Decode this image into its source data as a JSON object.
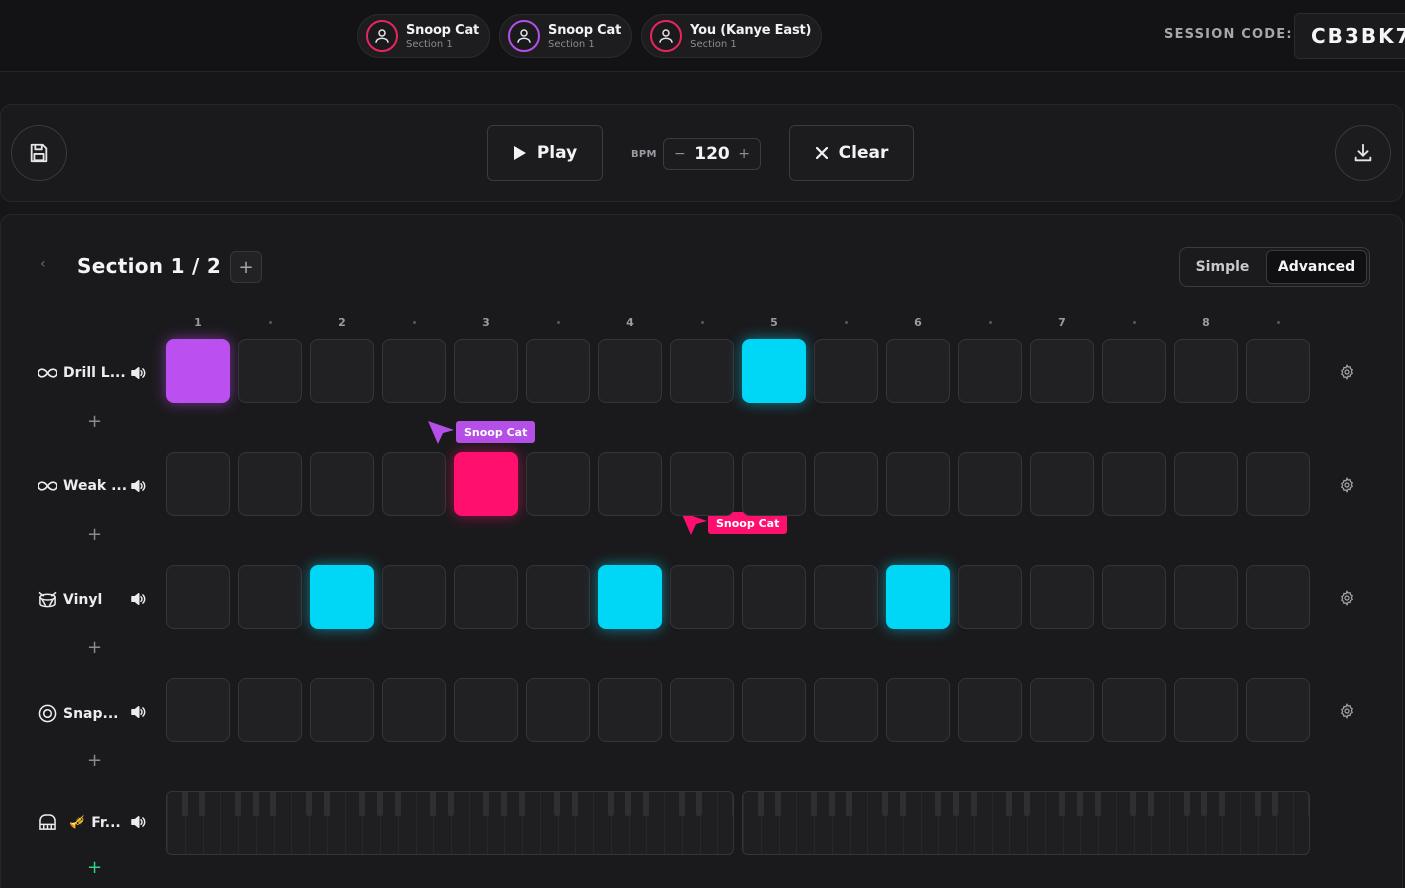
{
  "header": {
    "users": [
      {
        "name": "Snoop Cat",
        "section": "Section 1",
        "color": "#e8265e"
      },
      {
        "name": "Snoop Cat",
        "section": "Section 1",
        "color": "#b44fe8"
      },
      {
        "name": "You (Kanye East)",
        "section": "Section 1",
        "color": "#e8265e"
      }
    ],
    "session_label": "SESSION CODE:",
    "session_code": "CB3BK7"
  },
  "toolbar": {
    "save_icon": "save-icon",
    "play_label": "Play",
    "bpm_label": "BPM",
    "bpm_value": "120",
    "bpm_decrease": "−",
    "bpm_increase": "+",
    "clear_label": "Clear",
    "download_icon": "download-icon"
  },
  "section": {
    "prev": "‹",
    "title": "Section 1 / 2",
    "add": "+",
    "mode_simple": "Simple",
    "mode_advanced": "Advanced"
  },
  "steps": {
    "labels": [
      "1",
      "2",
      "3",
      "4",
      "5",
      "6",
      "7",
      "8"
    ]
  },
  "tracks": [
    {
      "name": "Drill L...",
      "icon": "loop-icon",
      "active": {
        "0": "purple",
        "8": "cyan"
      }
    },
    {
      "name": "Weak ...",
      "icon": "loop-icon",
      "active": {
        "4": "pink"
      }
    },
    {
      "name": "Vinyl",
      "icon": "drum-icon",
      "active": {
        "2": "cyan",
        "6": "cyan",
        "10": "cyan"
      }
    },
    {
      "name": "Snap...",
      "icon": "snap-icon",
      "active": {}
    },
    {
      "name": "Fr...",
      "icon": "piano-icon",
      "emoji": "🎺",
      "active": {}
    }
  ],
  "add_row_label": "+",
  "colors": {
    "purple": "#bb4ff0",
    "cyan": "#00d6f5",
    "pink": "#ff0f6e",
    "add_green": "#2ed18a"
  },
  "cursors": [
    {
      "name": "Snoop Cat",
      "color": "#b44fe8"
    },
    {
      "name": "Snoop Cat",
      "color": "#ff0f6e"
    }
  ]
}
